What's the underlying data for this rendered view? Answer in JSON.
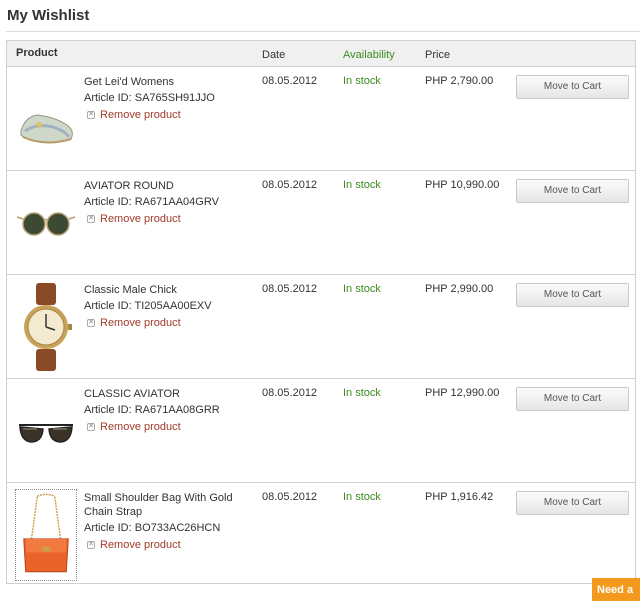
{
  "page": {
    "title": "My Wishlist"
  },
  "table": {
    "headers": {
      "product": "Product",
      "date": "Date",
      "availability": "Availability",
      "price": "Price"
    }
  },
  "items": [
    {
      "name": "Get Lei'd Womens",
      "article": "Article ID: SA765SH91JJO",
      "remove": "Remove product",
      "date": "08.05.2012",
      "availability": "In stock",
      "price": "PHP 2,790.00",
      "cart": "Move to Cart",
      "image_icon": "shoe-icon"
    },
    {
      "name": "AVIATOR ROUND",
      "article": "Article ID: RA671AA04GRV",
      "remove": "Remove product",
      "date": "08.05.2012",
      "availability": "In stock",
      "price": "PHP 10,990.00",
      "cart": "Move to Cart",
      "image_icon": "round-sunglasses-icon"
    },
    {
      "name": "Classic Male Chick",
      "article": "Article ID: TI205AA00EXV",
      "remove": "Remove product",
      "date": "08.05.2012",
      "availability": "In stock",
      "price": "PHP 2,990.00",
      "cart": "Move to Cart",
      "image_icon": "wristwatch-icon"
    },
    {
      "name": "CLASSIC AVIATOR",
      "article": "Article ID: RA671AA08GRR",
      "remove": "Remove product",
      "date": "08.05.2012",
      "availability": "In stock",
      "price": "PHP 12,990.00",
      "cart": "Move to Cart",
      "image_icon": "aviator-sunglasses-icon"
    },
    {
      "name": "Small Shoulder Bag With Gold Chain Strap",
      "article": "Article ID: BO733AC26HCN",
      "remove": "Remove product",
      "date": "08.05.2012",
      "availability": "In stock",
      "price": "PHP 1,916.42",
      "cart": "Move to Cart",
      "image_icon": "handbag-icon"
    }
  ],
  "help_tab": {
    "label": "Need a"
  },
  "colors": {
    "availability": "#3c8c1e",
    "remove_link": "#a33a2a",
    "help_tab": "#f39a1e"
  }
}
